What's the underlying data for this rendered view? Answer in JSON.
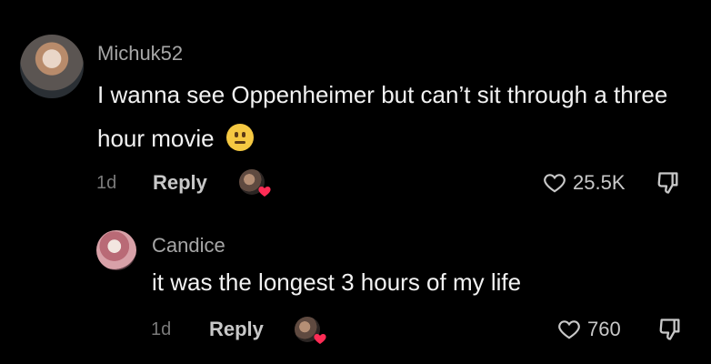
{
  "comments": [
    {
      "username": "Michuk52",
      "text": "I wanna see Oppenheimer but can’t sit through a three hour movie",
      "emoji_icon": "neutral-face-emoji",
      "time": "1d",
      "reply_label": "Reply",
      "likes": "25.5K"
    },
    {
      "username": "Candice",
      "text": "it was the longest 3 hours of my life",
      "time": "1d",
      "reply_label": "Reply",
      "likes": "760"
    }
  ],
  "colors": {
    "background": "#000000",
    "username": "#a6a6a6",
    "text": "#f2f2f2",
    "meta": "#7a7a7a",
    "heart_accent": "#fe2c55"
  }
}
